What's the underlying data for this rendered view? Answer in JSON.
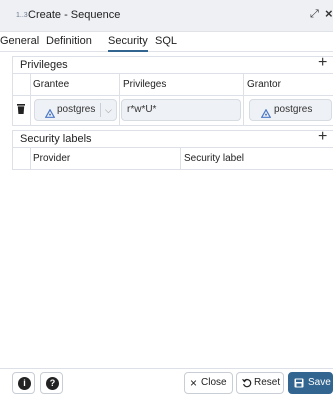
{
  "window": {
    "title_icon": "1..3",
    "title": "Create - Sequence",
    "expand_glyph": "⤢",
    "close_glyph": "×"
  },
  "tabs": [
    {
      "label": "General",
      "active": false
    },
    {
      "label": "Definition",
      "active": false
    },
    {
      "label": "Security",
      "active": true
    },
    {
      "label": "SQL",
      "active": false
    }
  ],
  "privileges": {
    "title": "Privileges",
    "add_glyph": "+",
    "columns": [
      "Grantee",
      "Privileges",
      "Grantor"
    ],
    "row": {
      "grantee": "postgres",
      "privileges": "r*w*U*",
      "grantor": "postgres"
    }
  },
  "security_labels": {
    "title": "Security labels",
    "add_glyph": "+",
    "columns": [
      "Provider",
      "Security label"
    ]
  },
  "footer": {
    "info_glyph": "i",
    "help_glyph": "?",
    "close_label": "Close",
    "reset_label": "Reset",
    "save_label": "Save"
  },
  "colors": {
    "accent": "#326690",
    "titlebar_bg": "#eef0f4",
    "border": "#dde0e6",
    "input_bg": "#eef1f5"
  }
}
